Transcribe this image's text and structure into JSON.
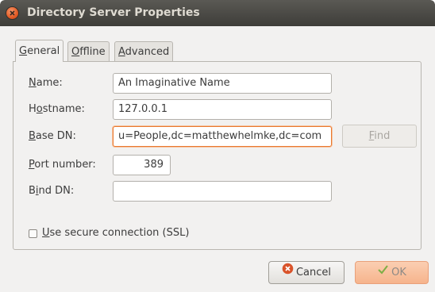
{
  "window": {
    "title": "Directory Server Properties"
  },
  "tabs": [
    {
      "pre": "",
      "accel": "G",
      "post": "eneral"
    },
    {
      "pre": "",
      "accel": "O",
      "post": "ffline"
    },
    {
      "pre": "",
      "accel": "A",
      "post": "dvanced"
    }
  ],
  "form": {
    "name": {
      "accel": "N",
      "rest": "ame:",
      "value": "An Imaginative Name"
    },
    "hostname": {
      "pre": "H",
      "accel": "o",
      "rest": "stname:",
      "value": "127.0.0.1"
    },
    "base_dn": {
      "accel": "B",
      "rest": "ase DN:",
      "value": "u=People,dc=matthewhelmke,dc=com"
    },
    "port": {
      "accel": "P",
      "rest": "ort number:",
      "value": "389"
    },
    "bind_dn": {
      "pre": "B",
      "accel": "i",
      "rest": "nd DN:",
      "value": ""
    },
    "find_button": {
      "accel": "F",
      "rest": "ind"
    },
    "ssl": {
      "accel": "U",
      "rest": "se secure connection (SSL)",
      "checked": false
    }
  },
  "buttons": {
    "cancel": {
      "label": "Cancel",
      "icon": "cancel-icon"
    },
    "ok": {
      "label": "OK",
      "icon": "checkmark-icon"
    }
  },
  "colors": {
    "accent": "#e8782f",
    "titlebar": "#3e3d39",
    "close": "#e25a24"
  }
}
